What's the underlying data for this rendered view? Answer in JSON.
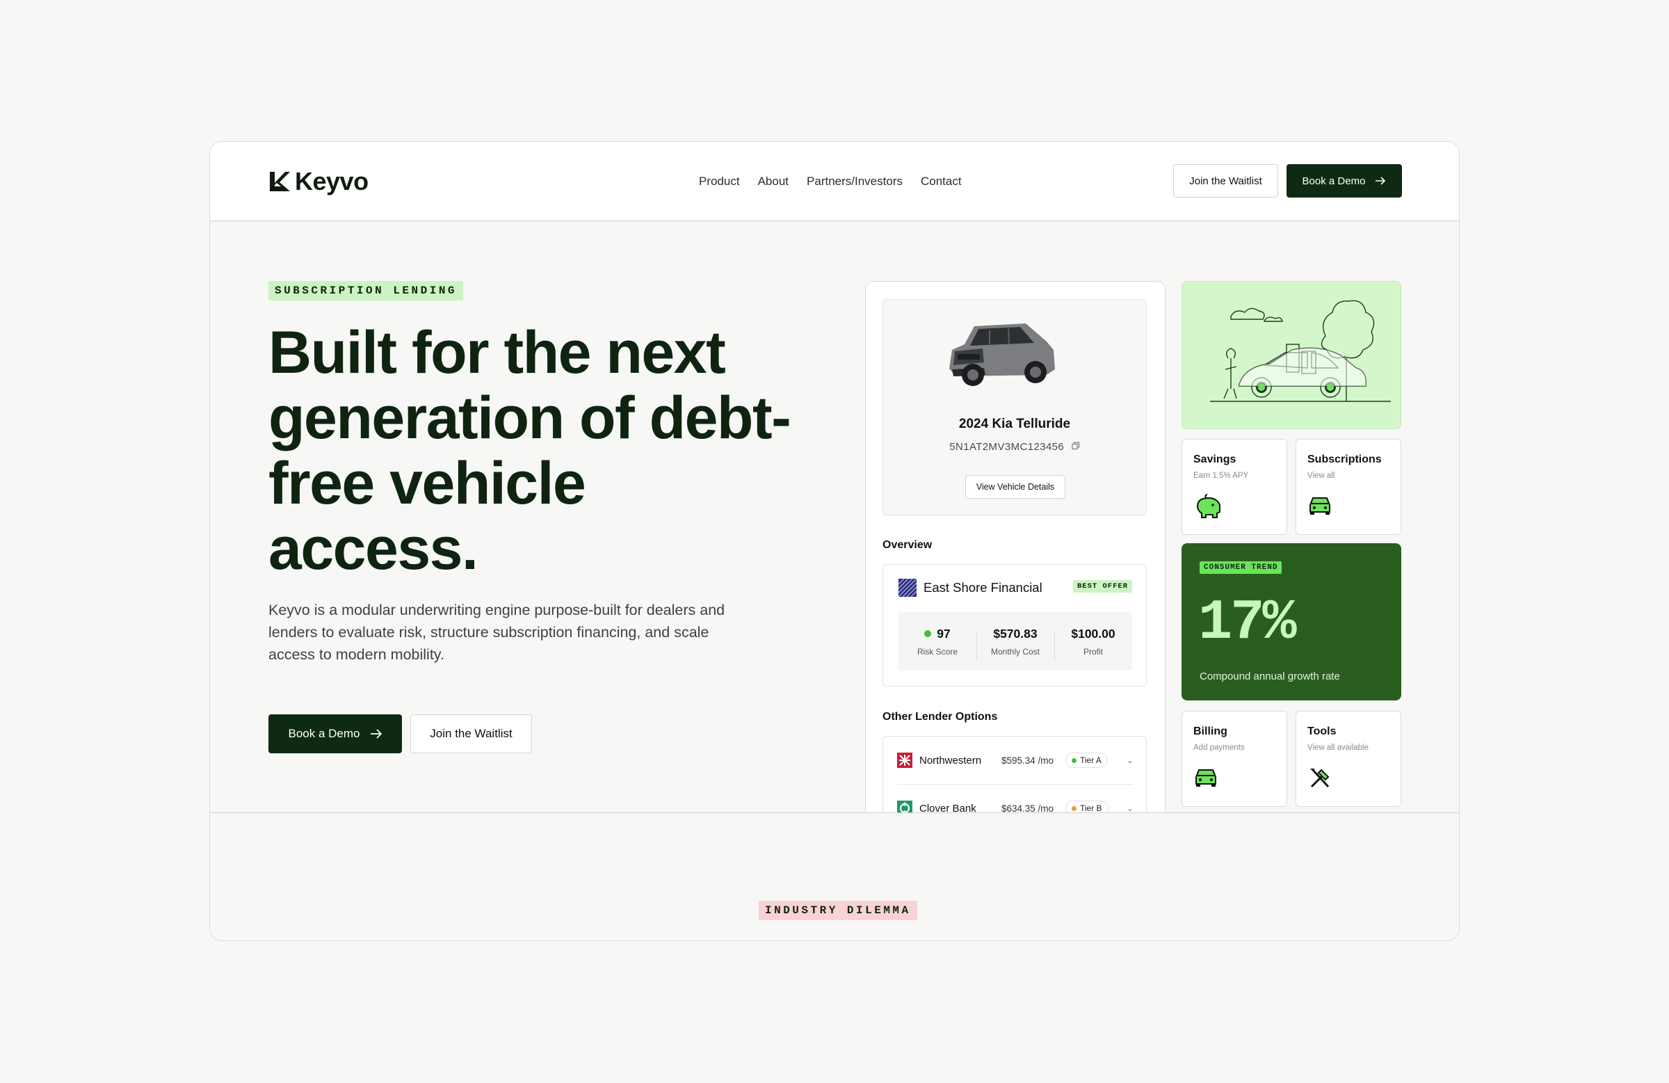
{
  "brand": {
    "name": "Keyvo"
  },
  "nav": {
    "items": [
      "Product",
      "About",
      "Partners/Investors",
      "Contact"
    ]
  },
  "header": {
    "waitlist_label": "Join the Waitlist",
    "demo_label": "Book a Demo"
  },
  "hero": {
    "eyebrow": "SUBSCRIPTION LENDING",
    "title": "Built for the next generation of debt-free vehicle access.",
    "description": "Keyvo is a modular underwriting engine purpose-built for dealers and lenders to evaluate risk, structure subscription financing, and scale access to modern mobility.",
    "demo_label": "Book a Demo",
    "waitlist_label": "Join the Waitlist"
  },
  "vehicle": {
    "name": "2024 Kia Telluride",
    "vin": "5N1AT2MV3MC123456",
    "details_label": "View Vehicle Details"
  },
  "overview": {
    "label": "Overview",
    "lender": "East Shore Financial",
    "badge": "BEST OFFER",
    "metrics": [
      {
        "value": "97",
        "label": "Risk Score"
      },
      {
        "value": "$570.83",
        "label": "Monthly Cost"
      },
      {
        "value": "$100.00",
        "label": "Profit"
      }
    ]
  },
  "other_lenders": {
    "label": "Other Lender Options",
    "rows": [
      {
        "name": "Northwestern",
        "price": "$595.34 /mo",
        "tier": "Tier A",
        "tier_color": "#3fbf3a"
      },
      {
        "name": "Clover Bank",
        "price": "$634.35 /mo",
        "tier": "Tier B",
        "tier_color": "#e59a3a"
      }
    ]
  },
  "cards": {
    "savings": {
      "title": "Savings",
      "sub": "Earn 1.5% APY"
    },
    "subscriptions": {
      "title": "Subscriptions",
      "sub": "View all"
    },
    "billing": {
      "title": "Billing",
      "sub": "Add payments"
    },
    "tools": {
      "title": "Tools",
      "sub": "View all available"
    }
  },
  "trend": {
    "badge": "CONSUMER TREND",
    "value": "17%",
    "label": "Compound annual growth rate"
  },
  "next_section": {
    "eyebrow": "INDUSTRY DILEMMA"
  },
  "colors": {
    "brand_dark": "#0f2a12",
    "accent_green": "#6be35a",
    "light_green": "#d3f7cb",
    "trend_bg": "#2a5e1f"
  }
}
